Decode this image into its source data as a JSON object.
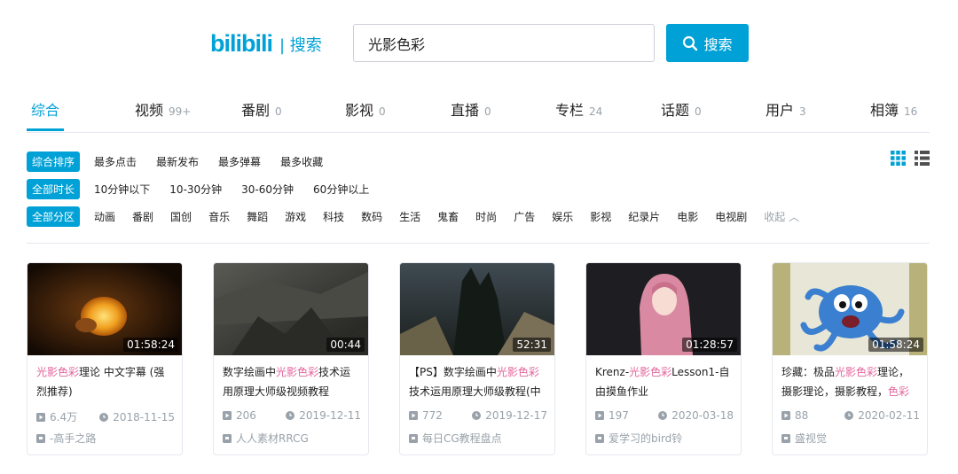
{
  "header": {
    "logo": "bilibili",
    "logo_suffix": "| 搜索",
    "search_value": "光影色彩",
    "search_button": "搜索"
  },
  "tabs": [
    {
      "label": "综合",
      "count": ""
    },
    {
      "label": "视频",
      "count": "99+"
    },
    {
      "label": "番剧",
      "count": "0"
    },
    {
      "label": "影视",
      "count": "0"
    },
    {
      "label": "直播",
      "count": "0"
    },
    {
      "label": "专栏",
      "count": "24"
    },
    {
      "label": "话题",
      "count": "0"
    },
    {
      "label": "用户",
      "count": "3"
    },
    {
      "label": "相簿",
      "count": "16"
    }
  ],
  "filters": {
    "sort": {
      "selected": "综合排序",
      "options": [
        "最多点击",
        "最新发布",
        "最多弹幕",
        "最多收藏"
      ]
    },
    "duration": {
      "selected": "全部时长",
      "options": [
        "10分钟以下",
        "10-30分钟",
        "30-60分钟",
        "60分钟以上"
      ]
    },
    "zone": {
      "selected": "全部分区",
      "options": [
        "动画",
        "番剧",
        "国创",
        "音乐",
        "舞蹈",
        "游戏",
        "科技",
        "数码",
        "生活",
        "鬼畜",
        "时尚",
        "广告",
        "娱乐",
        "影视",
        "纪录片",
        "电影",
        "电视剧"
      ],
      "collapse": "收起"
    }
  },
  "videos": [
    {
      "title_pre": "",
      "title_hl": "光影色彩",
      "title_post": "理论 中文字幕 (强烈推荐)",
      "duration": "01:58:24",
      "views": "6.4万",
      "date": "2018-11-15",
      "uploader": "-高手之路"
    },
    {
      "title_pre": "数字绘画中",
      "title_hl": "光影色彩",
      "title_post": "技术运用原理大师级视频教程",
      "duration": "00:44",
      "views": "206",
      "date": "2019-12-11",
      "uploader": "人人素材RRCG"
    },
    {
      "title_pre": "【PS】数字绘画中",
      "title_hl": "光影色彩",
      "title_post": "技术运用原理大师级教程(中",
      "duration": "52:31",
      "views": "772",
      "date": "2019-12-17",
      "uploader": "每日CG教程盘点"
    },
    {
      "title_pre": "Krenz-",
      "title_hl": "光影色彩",
      "title_post": "Lesson1-自由摸鱼作业",
      "duration": "01:28:57",
      "views": "197",
      "date": "2020-03-18",
      "uploader": "爱学习的bird铃"
    },
    {
      "title_pre": "珍藏：极品",
      "title_hl": "光影色彩",
      "title_post": "理论，摄影理论，摄影教程，",
      "title_hl2": "色彩",
      "duration": "01:58:24",
      "views": "88",
      "date": "2020-02-11",
      "uploader": "盛视觉"
    }
  ],
  "colors": {
    "accent": "#00a1d6",
    "highlight": "#e3659c",
    "muted": "#99a2aa"
  }
}
